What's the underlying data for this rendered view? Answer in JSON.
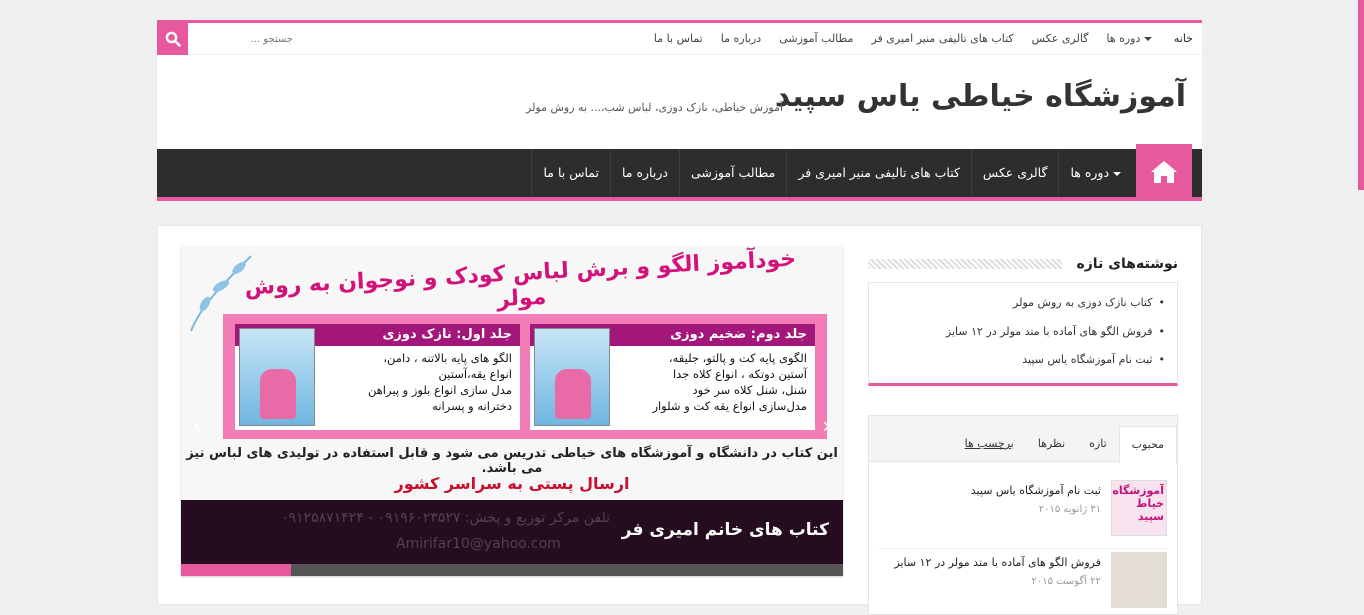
{
  "topnav": {
    "items": [
      {
        "label": "خانه",
        "active": true,
        "dropdown": false
      },
      {
        "label": "دوره ها",
        "active": false,
        "dropdown": true
      },
      {
        "label": "گالری عکس",
        "active": false,
        "dropdown": false
      },
      {
        "label": "کتاب های تالیفی منیر امیری فر",
        "active": false,
        "dropdown": false
      },
      {
        "label": "مطالب آموزشی",
        "active": false,
        "dropdown": false
      },
      {
        "label": "درباره ما",
        "active": false,
        "dropdown": false
      },
      {
        "label": "تماس با ما",
        "active": false,
        "dropdown": false
      }
    ],
    "search_placeholder": "جستجو ..."
  },
  "header": {
    "title": "آموزشگاه خیاطی یاس سپید",
    "tagline": "آموزش خیاطی، نازک دوزی، لباس شب،... به روش مولر"
  },
  "mainnav": {
    "items": [
      {
        "label": "دوره ها",
        "dropdown": true
      },
      {
        "label": "گالری عکس",
        "dropdown": false
      },
      {
        "label": "کتاب های تالیفی منیر امیری فر",
        "dropdown": false
      },
      {
        "label": "مطالب آموزشی",
        "dropdown": false
      },
      {
        "label": "درباره ما",
        "dropdown": false
      },
      {
        "label": "تماس با ما",
        "dropdown": false
      }
    ]
  },
  "slider": {
    "headline": "خودآموز الگو و برش لباس کودک و نوجوان به روش مولر",
    "vol2_caption": "جلد دوم: ضخیم دوزی",
    "vol2_text": "الگوی پایه کت و پالتو، جلیقه،\nآستین دوتکه ، انواع کلاه جدا\nشنل، شنل کلاه سر خود\nمدل‌سازی انواع یقه کت و شلوار",
    "vol1_caption": "جلد اول: نازک دوزی",
    "vol1_text": "الگو های پایه بالاتنه ، دامن،\nانواع یقه،آستین\nمدل سازی انواع بلوز و پیراهن\nدخترانه و پسرانه",
    "line1": "این کتاب در دانشگاه و آموزشگاه های خیاطی تدریس می شود و قابل استفاده در تولیدی های لباس نیز می باشد.",
    "line2": "ارسال پستی به سراسر کشور",
    "faint_phone": "تلفن مرکز توزیع و پخش: ۰۹۱۹۶۰۲۳۵۲۷ - ۰۹۱۲۵۸۷۱۴۲۴",
    "faint_email": "Amirifar10@yahoo.com",
    "caption_title": "کتاب های خانم امیری فر",
    "progress": 0.166
  },
  "recent": {
    "title": "نوشته‌های تازه",
    "items": [
      "کتاب نازک دوزی به روش مولر",
      "فروش الگو های آماده با متد مولر در ۱۲ سایز",
      "ثبت نام آموزشگاه یاس سپید"
    ]
  },
  "tabs": {
    "items": [
      {
        "label": "محبوب",
        "active": true
      },
      {
        "label": "تازه",
        "active": false
      },
      {
        "label": "نظرها",
        "active": false
      },
      {
        "label": "برچسب ها",
        "active": false
      }
    ],
    "posts": [
      {
        "title": "ثبت نام آموزشگاه یاس سپید",
        "date": "۳۱ ژانویه ۲۰۱۵",
        "thumb_text": "آموزشگاه خیاط سپید"
      },
      {
        "title": "فروش الگو های آماده با متد مولر در ۱۲ سایز",
        "date": "۲۲ آگوست ۲۰۱۵",
        "thumb_text": ""
      }
    ]
  },
  "colors": {
    "accent": "#e8589d",
    "nav": "#2d2d2d"
  }
}
